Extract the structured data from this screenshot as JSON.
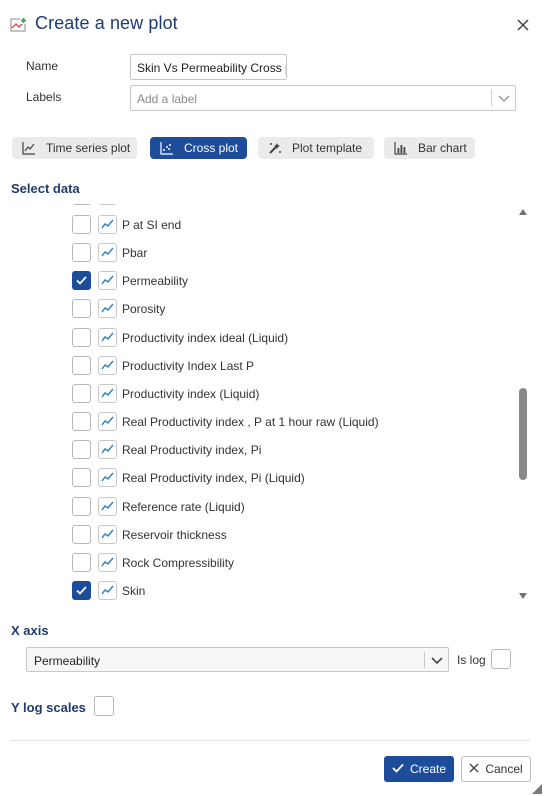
{
  "dialog": {
    "title": "Create a new plot",
    "title_icon": "add-plot-icon",
    "close_icon": "close-icon"
  },
  "form": {
    "name_label": "Name",
    "name_value": "Skin Vs Permeability Cross plot",
    "labels_label": "Labels",
    "labels_placeholder": "Add a label"
  },
  "plot_types": [
    {
      "label": "Time series plot",
      "icon": "time-series-icon",
      "active": false
    },
    {
      "label": "Cross plot",
      "icon": "cross-plot-icon",
      "active": true
    },
    {
      "label": "Plot template",
      "icon": "plot-template-icon",
      "active": false
    },
    {
      "label": "Bar chart",
      "icon": "bar-chart-icon",
      "active": false
    }
  ],
  "select_data": {
    "title": "Select data",
    "items": [
      {
        "label": "P at SI end",
        "checked": false
      },
      {
        "label": "Pbar",
        "checked": false
      },
      {
        "label": "Permeability",
        "checked": true
      },
      {
        "label": "Porosity",
        "checked": false
      },
      {
        "label": "Productivity index ideal (Liquid)",
        "checked": false
      },
      {
        "label": "Productivity Index Last P",
        "checked": false
      },
      {
        "label": "Productivity index (Liquid)",
        "checked": false
      },
      {
        "label": "Real Productivity index , P at 1 hour raw (Liquid)",
        "checked": false
      },
      {
        "label": "Real Productivity index, Pi",
        "checked": false
      },
      {
        "label": "Real Productivity index, Pi (Liquid)",
        "checked": false
      },
      {
        "label": "Reference rate (Liquid)",
        "checked": false
      },
      {
        "label": "Reservoir thickness",
        "checked": false
      },
      {
        "label": "Rock Compressibility",
        "checked": false
      },
      {
        "label": "Skin",
        "checked": true
      }
    ]
  },
  "x_axis": {
    "title": "X axis",
    "selected": "Permeability",
    "is_log_label": "Is log",
    "is_log": false
  },
  "y_axis": {
    "log_label": "Y log scales",
    "is_log": false
  },
  "buttons": {
    "create": "Create",
    "cancel": "Cancel"
  },
  "colors": {
    "accent": "#1d4c9b",
    "title": "#1f3b70"
  }
}
